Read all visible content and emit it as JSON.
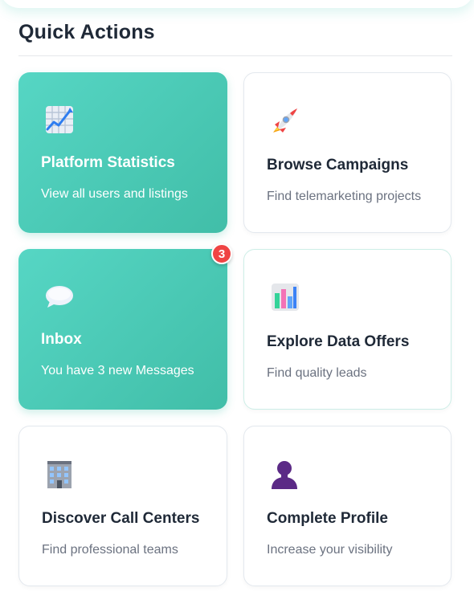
{
  "section": {
    "title": "Quick Actions"
  },
  "cards": [
    {
      "title": "Platform Statistics",
      "desc": "View all users and listings",
      "icon": "chart-increasing-icon"
    },
    {
      "title": "Browse Campaigns",
      "desc": "Find telemarketing projects",
      "icon": "rocket-icon"
    },
    {
      "title": "Inbox",
      "desc": "You have 3 new Messages",
      "icon": "speech-balloon-icon",
      "badge": "3"
    },
    {
      "title": "Explore Data Offers",
      "desc": "Find quality leads",
      "icon": "bar-chart-icon"
    },
    {
      "title": "Discover Call Centers",
      "desc": "Find professional teams",
      "icon": "office-building-icon"
    },
    {
      "title": "Complete Profile",
      "desc": "Increase your visibility",
      "icon": "person-silhouette-icon"
    }
  ],
  "colors": {
    "primary_gradient_start": "#56d6c4",
    "primary_gradient_end": "#41bea8",
    "badge": "#ef4444",
    "title_text": "#1f2937",
    "muted_text": "#6b7280"
  }
}
